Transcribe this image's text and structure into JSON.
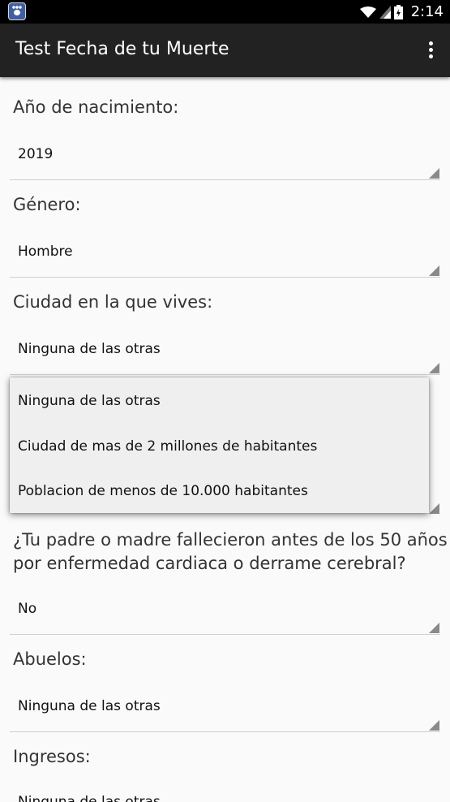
{
  "status_bar": {
    "time": "2:14"
  },
  "app_bar": {
    "title": "Test Fecha de tu Muerte"
  },
  "fields": [
    {
      "label": "Año de nacimiento:",
      "value": "2019"
    },
    {
      "label": "Género:",
      "value": "Hombre"
    },
    {
      "label": "Ciudad en la que vives:",
      "value": "Ninguna de las otras"
    },
    {
      "label_line1": "¿Tu padre o madre fallecieron antes de los 50 años",
      "label_line2": "por enfermedad cardiaca o derrame cerebral?",
      "value": "No"
    },
    {
      "label": "Abuelos:",
      "value": "Ninguna de las otras"
    },
    {
      "label": "Ingresos:",
      "value": "Ninguna de las otras"
    }
  ],
  "dropdown": {
    "options": [
      "Ninguna de las otras",
      "Ciudad de mas de 2 millones de habitantes",
      "Poblacion de menos de 10.000 habitantes"
    ]
  }
}
